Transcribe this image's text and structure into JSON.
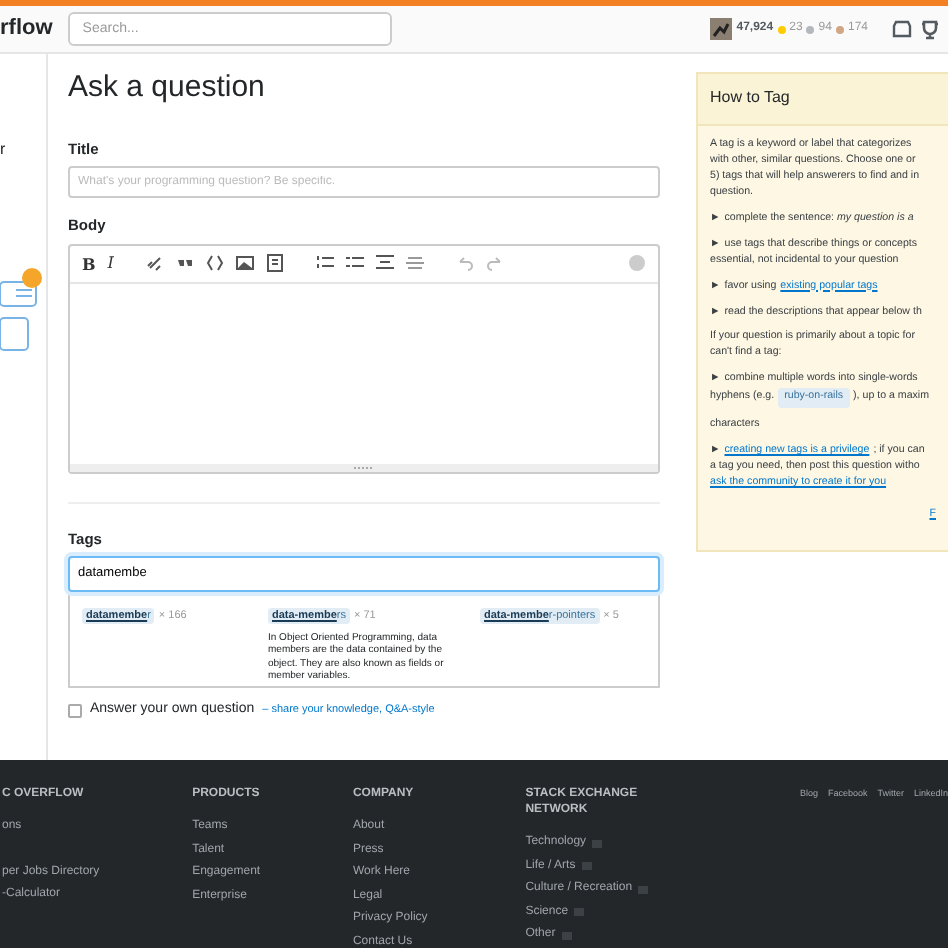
{
  "header": {
    "logo_text": "rflow",
    "search": {
      "placeholder": "Search..."
    },
    "reputation": "47,924",
    "badges": [
      {
        "count": "23",
        "color": "#ffcc01"
      },
      {
        "count": "94",
        "color": "#b4b8bc"
      },
      {
        "count": "174",
        "color": "#d1a684"
      }
    ]
  },
  "sidebar": {
    "text": "r"
  },
  "page_title": "Ask a question",
  "title_field": {
    "label": "Title",
    "placeholder": "What's your programming question? Be specific."
  },
  "body_field": {
    "label": "Body",
    "toolbar": [
      {
        "kind": "bold",
        "text": "B"
      },
      {
        "kind": "italic",
        "text": "I"
      },
      {
        "kind": "gap"
      },
      {
        "kind": "link"
      },
      {
        "kind": "quote"
      },
      {
        "kind": "code"
      },
      {
        "kind": "image"
      },
      {
        "kind": "snippet"
      },
      {
        "kind": "gap"
      },
      {
        "kind": "olist"
      },
      {
        "kind": "ulist"
      },
      {
        "kind": "heading"
      },
      {
        "kind": "rule"
      },
      {
        "kind": "gap"
      },
      {
        "kind": "undo"
      },
      {
        "kind": "redo"
      },
      {
        "kind": "spacer"
      },
      {
        "kind": "help"
      }
    ]
  },
  "tags_field": {
    "label": "Tags",
    "value": "datamembe",
    "suggestions": [
      {
        "tag": "**datamembe**r",
        "count": "× 166"
      },
      {
        "tag": "**data-membe**rs",
        "count": "× 71",
        "description": "In Object Oriented Programming, data members are the data contained by the object. They are also known as fields or member variables."
      },
      {
        "tag": "**data-membe**r-pointers",
        "count": "× 5"
      }
    ]
  },
  "answer_own": {
    "label": "Answer your own question",
    "checked": false,
    "link": "– share your knowledge, Q&A-style"
  },
  "how_to_tag": {
    "title": "How to Tag",
    "blocks": [
      {
        "lines": [
          [
            {
              "kind": "text",
              "text": "A tag is a keyword or label that categorizes"
            }
          ],
          [
            {
              "kind": "text",
              "text": "with other, similar questions. Choose one or"
            }
          ],
          [
            {
              "kind": "text",
              "text": "5) tags that will help answerers to find and in"
            }
          ],
          [
            {
              "kind": "text",
              "text": "question."
            }
          ]
        ]
      },
      {
        "lines": [
          [
            {
              "kind": "bullet",
              "text": "►"
            },
            {
              "kind": "text",
              "text": "complete the sentence: *my question is a*"
            }
          ]
        ]
      },
      {
        "lines": [
          [
            {
              "kind": "bullet",
              "text": "►"
            },
            {
              "kind": "text",
              "text": "use tags that describe things or concepts"
            }
          ],
          [
            {
              "kind": "text",
              "text": "essential, not incidental to your question"
            }
          ]
        ]
      },
      {
        "lines": [
          [
            {
              "kind": "bullet",
              "text": "►"
            },
            {
              "kind": "text",
              "text": "favor using"
            },
            {
              "kind": "link",
              "text": "existing popular tags"
            }
          ]
        ]
      },
      {
        "lines": [
          [
            {
              "kind": "bullet",
              "text": "►"
            },
            {
              "kind": "text",
              "text": "read the descriptions that appear below th"
            }
          ]
        ]
      },
      {
        "lines": [
          [
            {
              "kind": "text",
              "text": "If your question is primarily about a topic for"
            }
          ],
          [
            {
              "kind": "text",
              "text": "can't find a tag:"
            }
          ]
        ]
      },
      {
        "lines": [
          [
            {
              "kind": "bullet",
              "text": "►"
            },
            {
              "kind": "text",
              "text": "combine multiple words into single-words"
            }
          ],
          [
            {
              "kind": "text",
              "text": "hyphens (e.g."
            },
            {
              "kind": "tag",
              "text": "ruby-on-rails"
            },
            {
              "kind": "text",
              "text": "), up to a maxim"
            }
          ]
        ]
      },
      {
        "lines": [
          [
            {
              "kind": "text",
              "text": "characters"
            }
          ]
        ]
      },
      {
        "lines": [
          [
            {
              "kind": "bullet",
              "text": "►"
            },
            {
              "kind": "link",
              "text": "creating new tags is a privilege"
            },
            {
              "kind": "text",
              "text": "; if you can"
            }
          ],
          [
            {
              "kind": "text",
              "text": "a tag you need, then post this question witho"
            }
          ],
          [
            {
              "kind": "link",
              "text": "ask the community to create it for you"
            }
          ]
        ]
      }
    ],
    "footer_link": "F"
  },
  "footer": {
    "columns": [
      {
        "heading": "C OVERFLOW",
        "links": [
          {
            "text": "ons"
          },
          {
            "text": "per Jobs Directory"
          },
          {
            "text": "-Calculator"
          }
        ]
      },
      {
        "heading": "PRODUCTS",
        "links": [
          {
            "text": "Teams"
          },
          {
            "text": "Talent"
          },
          {
            "text": "Engagement"
          },
          {
            "text": "Enterprise"
          }
        ]
      },
      {
        "heading": "COMPANY",
        "links": [
          {
            "text": "About"
          },
          {
            "text": "Press"
          },
          {
            "text": "Work Here"
          },
          {
            "text": "Legal"
          },
          {
            "text": "Privacy Policy"
          },
          {
            "text": "Contact Us"
          }
        ]
      },
      {
        "heading": "STACK EXCHANGE NETWORK",
        "links": [
          {
            "text": "Technology",
            "more": true
          },
          {
            "text": "Life / Arts",
            "more": true
          },
          {
            "text": "Culture / Recreation",
            "more": true
          },
          {
            "text": "Science",
            "more": true
          },
          {
            "text": "Other",
            "more": true
          }
        ]
      }
    ],
    "social": [
      "Blog",
      "Facebook",
      "Twitter",
      "LinkedIn"
    ]
  }
}
